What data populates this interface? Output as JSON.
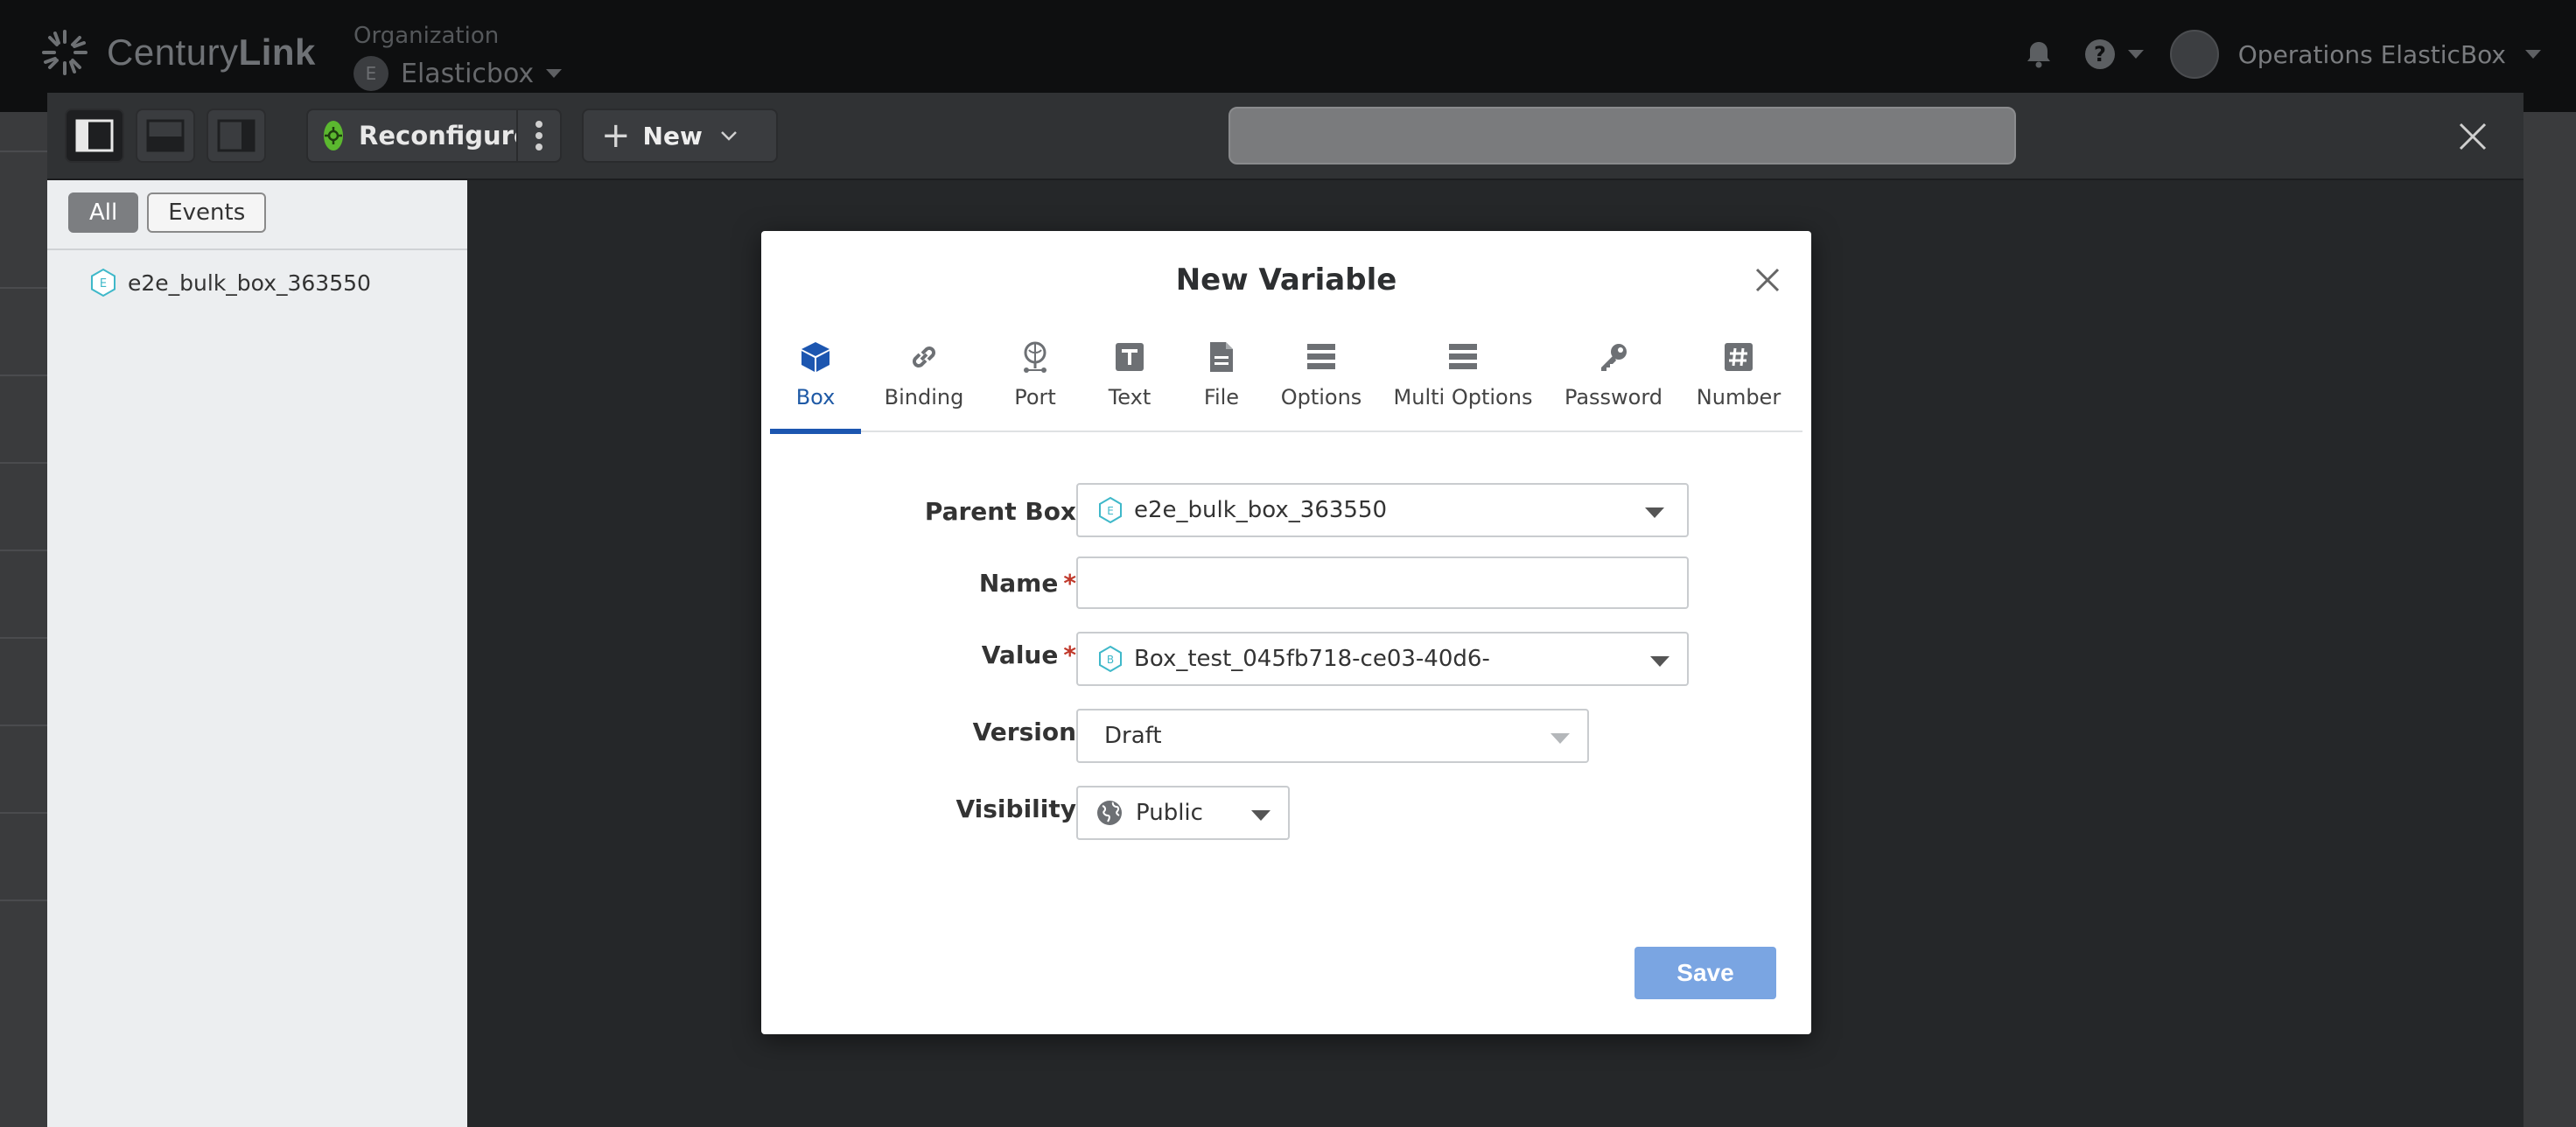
{
  "header": {
    "logo_text_light": "Century",
    "logo_text_bold": "Link",
    "org_label": "Organization",
    "org_avatar": "E",
    "org_name": "Elasticbox",
    "user_name": "Operations ElasticBox",
    "icons": [
      "bell-icon",
      "help-icon",
      "chevron-down-icon"
    ]
  },
  "toolbar": {
    "reconfigure_label": "Reconfigure",
    "new_label": "New",
    "search_value": ""
  },
  "left_panel": {
    "filters": [
      "All",
      "Events"
    ],
    "active_filter": "All",
    "tree": [
      {
        "badge": "E",
        "label": "e2e_bulk_box_363550"
      }
    ]
  },
  "modal": {
    "title": "New Variable",
    "tabs": [
      {
        "label": "Box",
        "icon": "cube-icon"
      },
      {
        "label": "Binding",
        "icon": "link-icon"
      },
      {
        "label": "Port",
        "icon": "port-icon"
      },
      {
        "label": "Text",
        "icon": "text-icon"
      },
      {
        "label": "File",
        "icon": "file-icon"
      },
      {
        "label": "Options",
        "icon": "list-icon"
      },
      {
        "label": "Multi Options",
        "icon": "list-icon"
      },
      {
        "label": "Password",
        "icon": "key-icon"
      },
      {
        "label": "Number",
        "icon": "hash-icon"
      }
    ],
    "active_tab": "Box",
    "fields": {
      "parent_box": {
        "label": "Parent Box",
        "badge": "E",
        "value": "e2e_bulk_box_363550"
      },
      "name": {
        "label": "Name",
        "required": "*",
        "value": ""
      },
      "value": {
        "label": "Value",
        "required": "*",
        "badge": "B",
        "value": "Box_test_045fb718-ce03-40d6-"
      },
      "version": {
        "label": "Version",
        "value": "Draft"
      },
      "visibility": {
        "label": "Visibility",
        "value": "Public"
      }
    },
    "save_label": "Save"
  },
  "colors": {
    "accent": "#1c56b0",
    "save_button": "#7aa5e2",
    "badge_teal": "#3fb8c9",
    "reconfigure_green": "#5bb82f"
  }
}
